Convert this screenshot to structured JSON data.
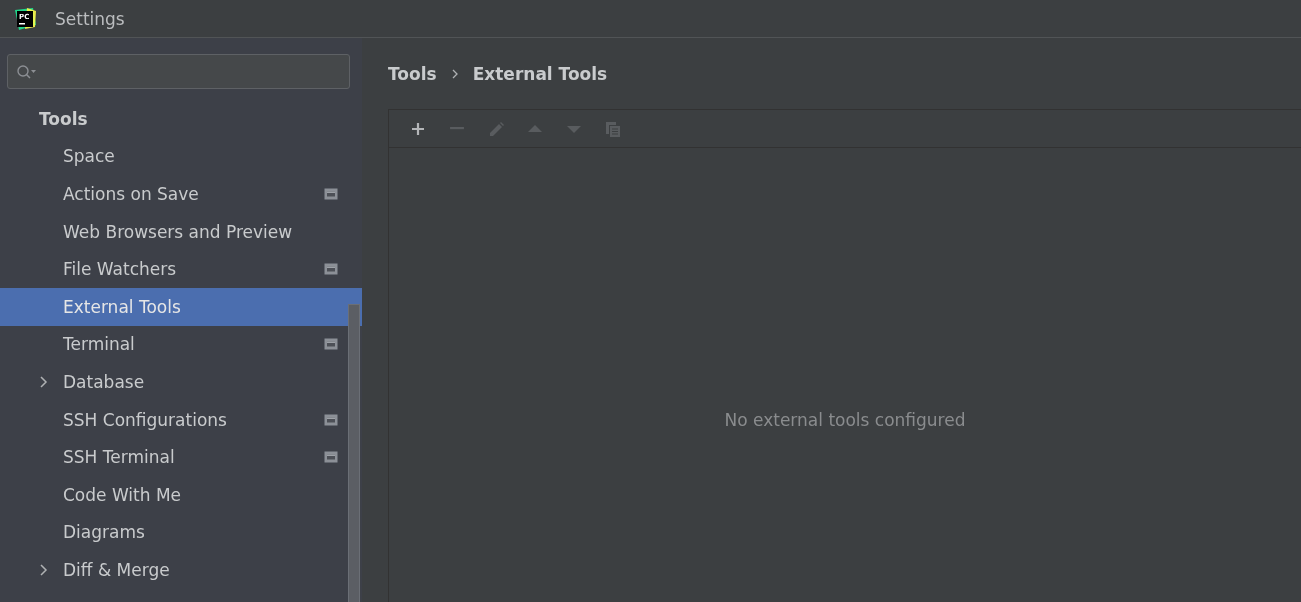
{
  "window": {
    "title": "Settings",
    "logo_text": "PC"
  },
  "sidebar": {
    "items": [
      {
        "label": "Tools",
        "kind": "group",
        "selected": false,
        "project_scoped": false
      },
      {
        "label": "Space",
        "kind": "item",
        "selected": false,
        "project_scoped": false
      },
      {
        "label": "Actions on Save",
        "kind": "item",
        "selected": false,
        "project_scoped": true
      },
      {
        "label": "Web Browsers and Preview",
        "kind": "item",
        "selected": false,
        "project_scoped": false
      },
      {
        "label": "File Watchers",
        "kind": "item",
        "selected": false,
        "project_scoped": true
      },
      {
        "label": "External Tools",
        "kind": "item",
        "selected": true,
        "project_scoped": false
      },
      {
        "label": "Terminal",
        "kind": "item",
        "selected": false,
        "project_scoped": true
      },
      {
        "label": "Database",
        "kind": "expandable",
        "selected": false,
        "project_scoped": false
      },
      {
        "label": "SSH Configurations",
        "kind": "item",
        "selected": false,
        "project_scoped": true
      },
      {
        "label": "SSH Terminal",
        "kind": "item",
        "selected": false,
        "project_scoped": true
      },
      {
        "label": "Code With Me",
        "kind": "item",
        "selected": false,
        "project_scoped": false
      },
      {
        "label": "Diagrams",
        "kind": "item",
        "selected": false,
        "project_scoped": false
      },
      {
        "label": "Diff & Merge",
        "kind": "expandable",
        "selected": false,
        "project_scoped": false
      }
    ]
  },
  "breadcrumb": [
    "Tools",
    "External Tools"
  ],
  "toolbar": [
    {
      "kind": "add",
      "disabled": false
    },
    {
      "kind": "remove",
      "disabled": true
    },
    {
      "kind": "edit",
      "disabled": true
    },
    {
      "kind": "up",
      "disabled": true
    },
    {
      "kind": "down",
      "disabled": true
    },
    {
      "kind": "copy",
      "disabled": true
    }
  ],
  "empty_text": "No external tools configured"
}
